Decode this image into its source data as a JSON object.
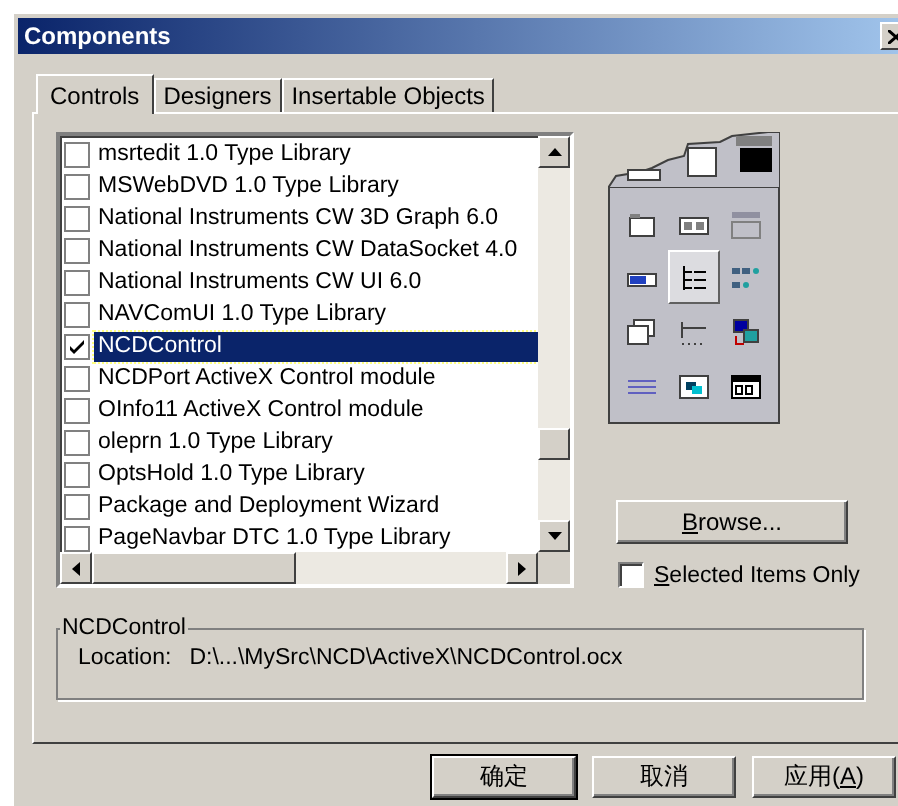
{
  "window": {
    "title": "Components"
  },
  "tabs": [
    {
      "label": "Controls",
      "selected": true
    },
    {
      "label": "Designers",
      "selected": false
    },
    {
      "label": "Insertable Objects",
      "selected": false
    }
  ],
  "components": [
    {
      "name": "msrtedit 1.0 Type Library",
      "checked": false,
      "selected": false
    },
    {
      "name": "MSWebDVD 1.0 Type Library",
      "checked": false,
      "selected": false
    },
    {
      "name": "National Instruments CW 3D Graph 6.0",
      "checked": false,
      "selected": false
    },
    {
      "name": "National Instruments CW DataSocket 4.0",
      "checked": false,
      "selected": false
    },
    {
      "name": "National Instruments CW UI 6.0",
      "checked": false,
      "selected": false
    },
    {
      "name": "NAVComUI 1.0 Type Library",
      "checked": false,
      "selected": false
    },
    {
      "name": "NCDControl",
      "checked": true,
      "selected": true
    },
    {
      "name": "NCDPort ActiveX Control module",
      "checked": false,
      "selected": false
    },
    {
      "name": "OInfo11 ActiveX Control module",
      "checked": false,
      "selected": false
    },
    {
      "name": "oleprn 1.0 Type Library",
      "checked": false,
      "selected": false
    },
    {
      "name": "OptsHold 1.0 Type Library",
      "checked": false,
      "selected": false
    },
    {
      "name": "Package and Deployment Wizard",
      "checked": false,
      "selected": false
    },
    {
      "name": "PageNavbar DTC 1.0 Type Library",
      "checked": false,
      "selected": false
    }
  ],
  "palette": [
    {
      "selected": false
    },
    {
      "selected": false
    },
    {
      "selected": false
    },
    {
      "selected": false
    },
    {
      "selected": true
    },
    {
      "selected": false
    },
    {
      "selected": false
    },
    {
      "selected": false
    },
    {
      "selected": false
    },
    {
      "selected": false
    },
    {
      "selected": false
    },
    {
      "selected": false
    }
  ],
  "browse_button": {
    "accel": "B",
    "after": "rowse..."
  },
  "selected_only": {
    "accel": "S",
    "after": "elected Items Only",
    "checked": false
  },
  "details": {
    "title": "NCDControl",
    "location_label": "Location:",
    "location": "D:\\...\\MySrc\\NCD\\ActiveX\\NCDControl.ocx"
  },
  "buttons": [
    {
      "before": "确定",
      "default": true
    },
    {
      "before": "取消",
      "default": false
    },
    {
      "before": "应用(",
      "accel": "A",
      "after": ")",
      "default": false
    }
  ]
}
